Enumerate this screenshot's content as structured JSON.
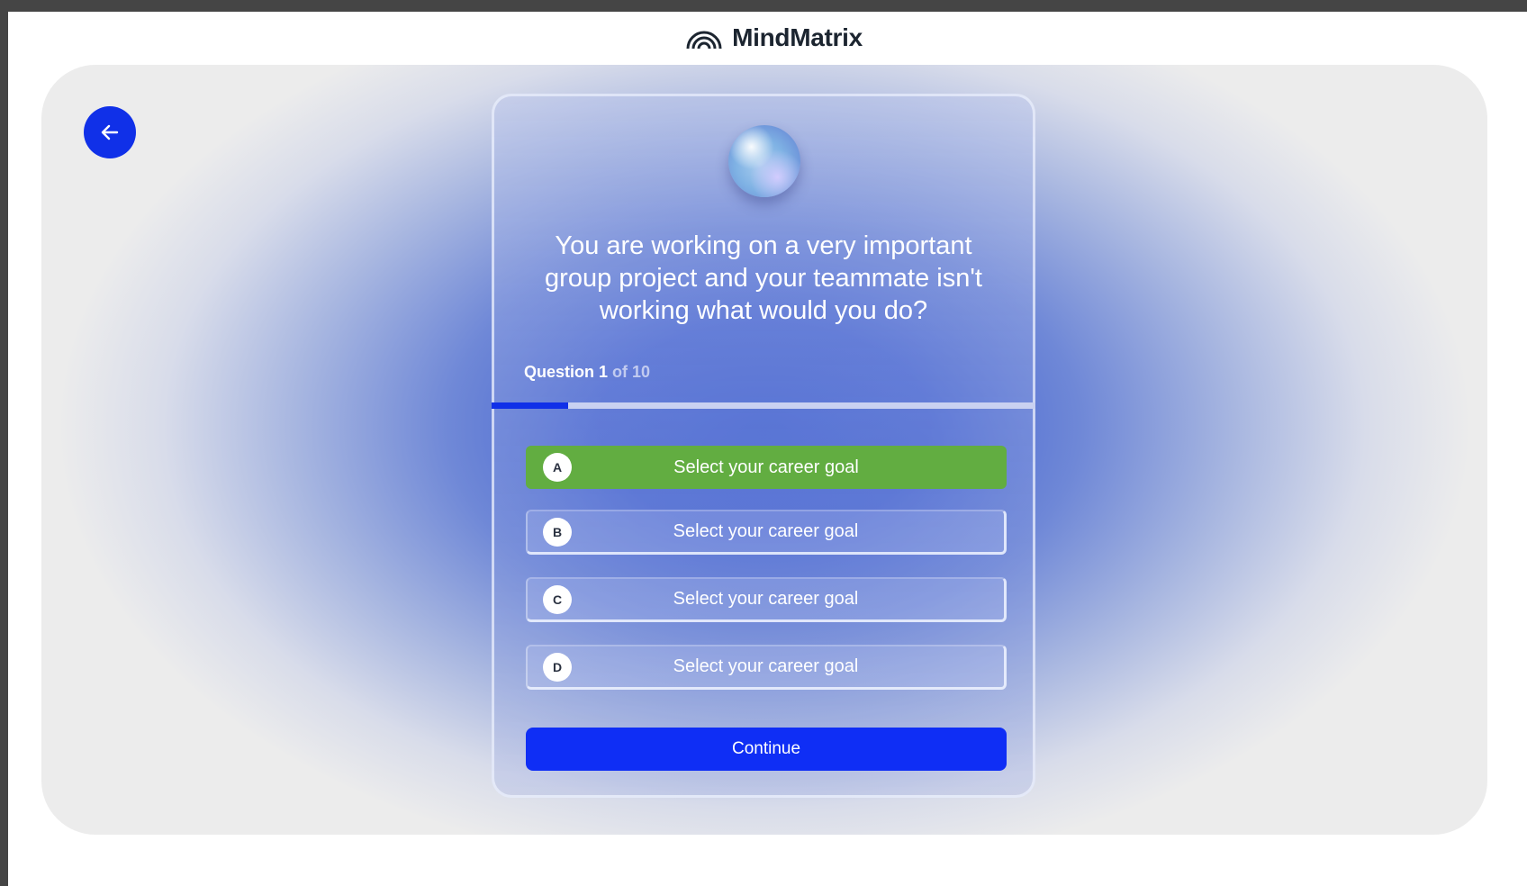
{
  "app": {
    "brand_name": "MindMatrix",
    "accent_color": "#1030e8",
    "selected_color": "#62ad41"
  },
  "nav": {
    "back_icon": "arrow-left-icon"
  },
  "quiz": {
    "question_text": "You are working on a very important group project and your teammate isn't working what would you do?",
    "progress": {
      "label_prefix": "Question 1",
      "label_suffix": " of 10",
      "current": 1,
      "total": 10
    },
    "options": [
      {
        "letter": "A",
        "text": "Select your career goal",
        "selected": true
      },
      {
        "letter": "B",
        "text": "Select your career goal",
        "selected": false
      },
      {
        "letter": "C",
        "text": "Select your career goal",
        "selected": false
      },
      {
        "letter": "D",
        "text": "Select your career goal",
        "selected": false
      }
    ],
    "continue_label": "Continue"
  }
}
